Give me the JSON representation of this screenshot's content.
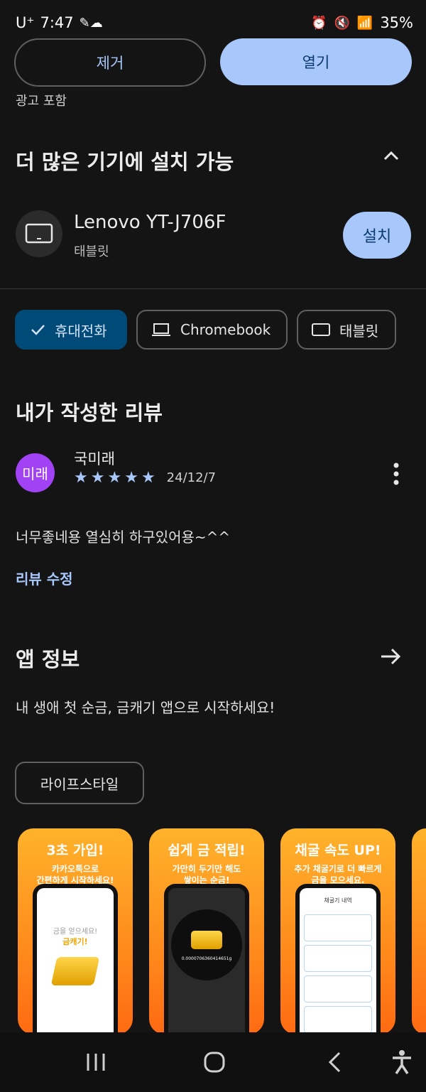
{
  "status_bar": {
    "carrier": "U⁺",
    "time": "7:47",
    "battery": "35%"
  },
  "top_actions": {
    "remove_label": "제거",
    "open_label": "열기"
  },
  "ads_note": "광고 포함",
  "devices": {
    "title": "더 많은 기기에 설치 가능",
    "device_name": "Lenovo YT-J706F",
    "device_type": "태블릿",
    "install_label": "설치"
  },
  "filter_chips": [
    {
      "label": "휴대전화",
      "active": true
    },
    {
      "label": "Chromebook",
      "active": false
    },
    {
      "label": "태블릿",
      "active": false
    }
  ],
  "my_review": {
    "title": "내가 작성한 리뷰",
    "avatar_text": "미래",
    "author": "국미래",
    "rating": 5,
    "date": "24/12/7",
    "text": "너무좋네용 열심히 하구있어용~^^",
    "edit_label": "리뷰 수정"
  },
  "app_info": {
    "title": "앱 정보",
    "description": "내 생애 첫 순금, 금캐기 앱으로 시작하세요!",
    "category_chip": "라이프스타일"
  },
  "screenshots": [
    {
      "headline": "3초 가입!",
      "sub": "카카오톡으로\n간편하게 시작하세요!",
      "screen_line1": "금을 얻으세요!",
      "screen_line2": "금캐기!"
    },
    {
      "headline": "쉽게 금 적립!",
      "sub": "가만히 두기만 해도\n쌓이는 순금!",
      "screen_value": "0.0000706360414651g"
    },
    {
      "headline": "채굴 속도 UP!",
      "sub": "추가 채굴기로 더 빠르게\n금을 모으세요.",
      "screen_title": "채굴기 내역"
    }
  ],
  "colors": {
    "background": "#141414",
    "accent": "#a8c7fa",
    "chip_active": "#004a77",
    "avatar": "#a142f4",
    "promo_orange": "#ff8a1c"
  }
}
